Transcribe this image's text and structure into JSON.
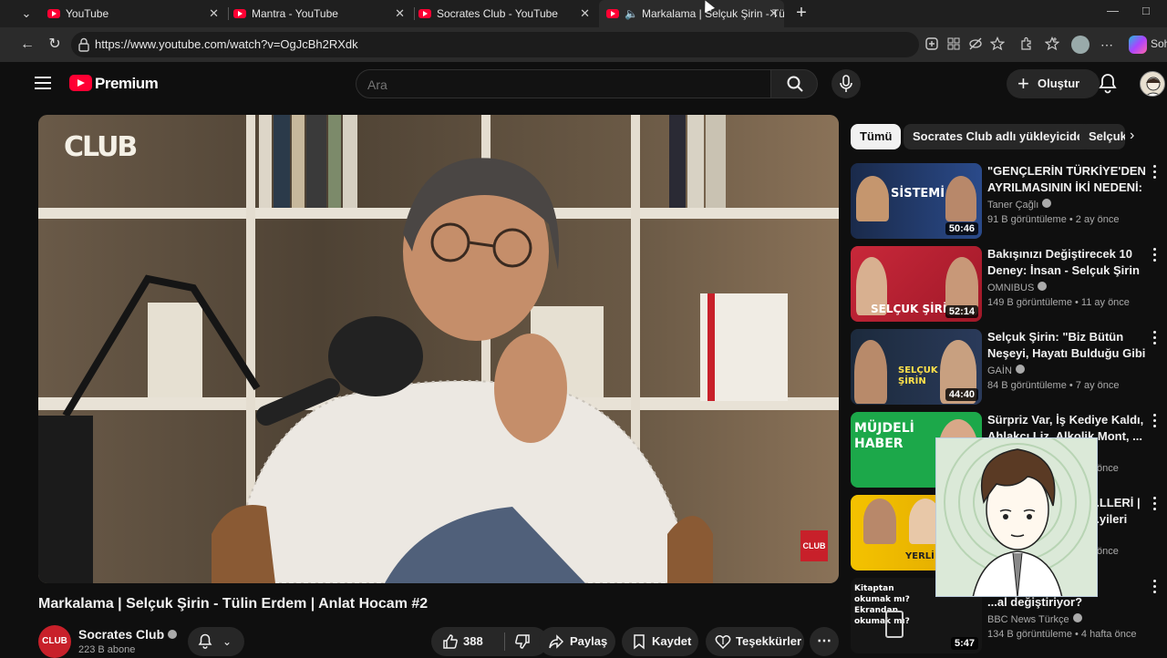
{
  "browser": {
    "tabs": [
      {
        "label": "YouTube",
        "active": false
      },
      {
        "label": "Mantra - YouTube",
        "active": false
      },
      {
        "label": "Socrates Club - YouTube",
        "active": false
      },
      {
        "label": "Markalama | Selçuk Şirin - Tül",
        "active": true
      }
    ],
    "url": "https://www.youtube.com/watch?v=OgJcBh2RXdk",
    "copilot_label": "Soh"
  },
  "youtube": {
    "brand": "Premium",
    "search_placeholder": "Ara",
    "create_label": "Oluştur",
    "colors": {
      "brand_red": "#ff0033",
      "bg": "#0f0f0f",
      "pill": "#272727"
    }
  },
  "video": {
    "overlay_logo": "CLUB",
    "badge": "CLUB",
    "title": "Markalama | Selçuk Şirin - Tülin Erdem | Anlat Hocam #2",
    "channel": {
      "name": "Socrates Club",
      "subs": "223 B abone",
      "avatar_text": "CLUB"
    },
    "actions": {
      "likes": "388",
      "share": "Paylaş",
      "save": "Kaydet",
      "thanks": "Teşekkürler"
    }
  },
  "sidebar": {
    "chips": [
      "Tümü",
      "Socrates Club adlı yükleyiciden",
      "Selçuk"
    ],
    "recommendations": [
      {
        "title": "\"GENÇLERİN TÜRKİYE'DEN AYRILMASININ İKİ NEDENİ: ...",
        "channel": "Taner Çağlı",
        "meta": "91 B görüntüleme • 2 ay önce",
        "duration": "50:46",
        "thumb_text": "SİSTEMİ"
      },
      {
        "title": "Bakışınızı Değiştirecek 10 Deney: İnsan - Selçuk Şirin & ...",
        "channel": "OMNIBUS",
        "meta": "149 B görüntüleme • 11 ay önce",
        "duration": "52:14",
        "thumb_text": "SELÇUK ŞİRİ"
      },
      {
        "title": "Selçuk Şirin: \"Biz Bütün Neşeyi, Hayatı Bulduğu Gibi ...",
        "channel": "GAİN",
        "meta": "84 B görüntüleme • 7 ay önce",
        "duration": "44:40",
        "thumb_text": "SELÇUK ŞİRİN"
      },
      {
        "title": "Sürpriz Var, İş Kediye Kaldı, Ahlakçı Liz, Alkolik Mont, ...",
        "channel": "",
        "meta": "önce",
        "duration": "",
        "thumb_text": "MÜJDELİ HABER"
      },
      {
        "title": "...LLERİ | ...yileri",
        "channel": "",
        "meta": "önce",
        "duration": "",
        "thumb_text": "YERLİ DİZİ"
      },
      {
        "title": "...al değiştiriyor?",
        "channel": "BBC News Türkçe",
        "meta": "134 B görüntüleme • 4 hafta önce",
        "duration": "5:47",
        "thumb_text": "Kitaptan okumak mı? Ekrandan okumak mı?"
      }
    ]
  }
}
